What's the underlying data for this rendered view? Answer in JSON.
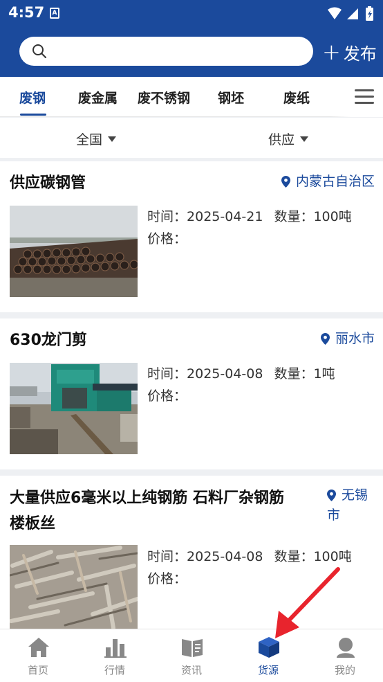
{
  "status_bar": {
    "time": "4:57",
    "notification_badge": "A"
  },
  "search": {
    "value": "",
    "placeholder": ""
  },
  "publish": {
    "label": "发布"
  },
  "tabs": [
    {
      "label": "废钢",
      "active": true
    },
    {
      "label": "废金属",
      "active": false
    },
    {
      "label": "废不锈钢",
      "active": false
    },
    {
      "label": "钢坯",
      "active": false
    },
    {
      "label": "废纸",
      "active": false
    }
  ],
  "filters": {
    "region": "全国",
    "type": "供应"
  },
  "listings": [
    {
      "title": "供应碳钢管",
      "location": "内蒙古自治区",
      "time_label": "时间：",
      "date": "2025-04-21",
      "qty_label": "数量：",
      "quantity": "100吨",
      "price_label": "价格：",
      "price": ""
    },
    {
      "title": "630龙门剪",
      "location": "丽水市",
      "time_label": "时间：",
      "date": "2025-04-08",
      "qty_label": "数量：",
      "quantity": "1吨",
      "price_label": "价格：",
      "price": ""
    },
    {
      "title_line1": "大量供应6毫米以上纯钢筋 石料厂杂钢筋",
      "title_line2": "楼板丝",
      "location_line1": "无锡",
      "location_line2": "市",
      "time_label": "时间：",
      "date": "2025-04-08",
      "qty_label": "数量：",
      "quantity": "100吨",
      "price_label": "价格：",
      "price": ""
    }
  ],
  "bottom_nav": [
    {
      "label": "首页",
      "icon": "home-icon",
      "active": false
    },
    {
      "label": "行情",
      "icon": "bar-chart-icon",
      "active": false
    },
    {
      "label": "资讯",
      "icon": "book-icon",
      "active": false
    },
    {
      "label": "货源",
      "icon": "cube-icon",
      "active": true
    },
    {
      "label": "我的",
      "icon": "user-icon",
      "active": false
    }
  ],
  "colors": {
    "primary": "#1b4a9c",
    "pointer": "#e8242d",
    "inactive": "#888888"
  }
}
